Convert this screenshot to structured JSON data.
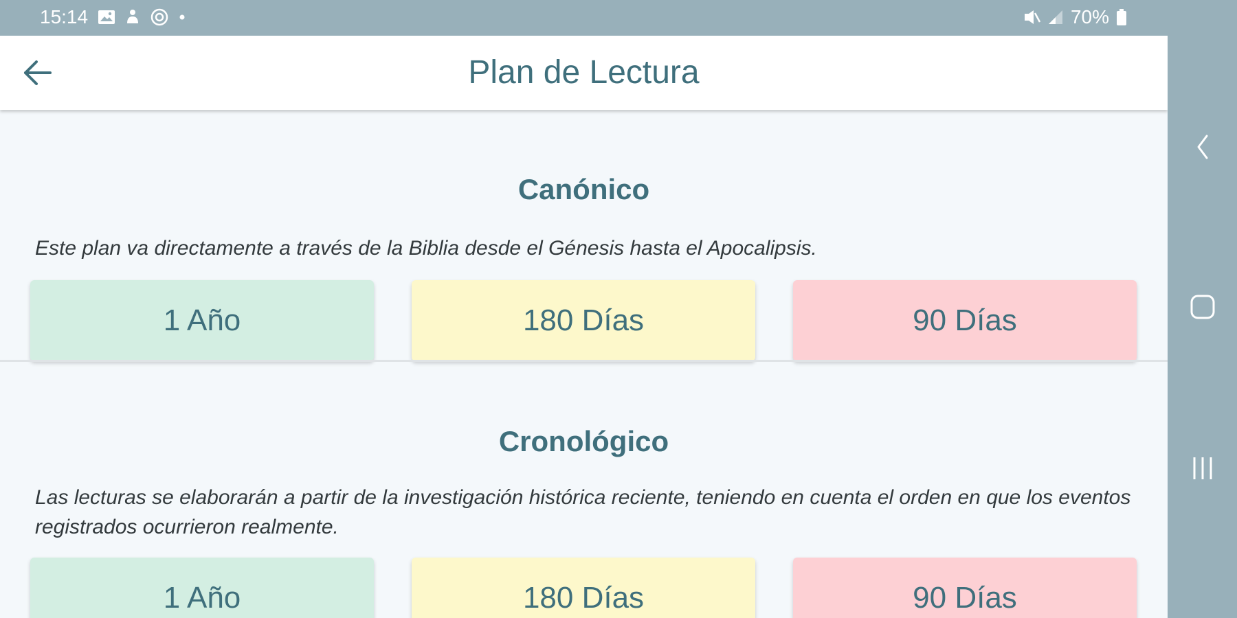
{
  "status_bar": {
    "time": "15:14",
    "battery": "70%",
    "icons": [
      "image-icon",
      "notification-icon",
      "at-sign-icon",
      "dot-icon",
      "mute-icon",
      "signal-icon",
      "battery-icon"
    ]
  },
  "app_bar": {
    "title": "Plan de Lectura",
    "back_icon": "arrow-left-icon"
  },
  "sections": [
    {
      "title": "Canónico",
      "description": "Este plan va directamente a través de la Biblia desde el Génesis hasta el Apocalipsis.",
      "options": [
        "1 Año",
        "180 Días",
        "90 Días"
      ]
    },
    {
      "title": "Cronológico",
      "description": "Las lecturas se elaborarán a partir de la investigación histórica reciente, teniendo en cuenta el orden en que los eventos registrados ocurrieron realmente.",
      "options": [
        "1 Año",
        "180 Días",
        "90 Días"
      ]
    }
  ],
  "colors": {
    "accent_text": "#3f6f7c",
    "status_bar": "#98b0ba",
    "option_green": "#d3eee2",
    "option_yellow": "#fdf8cb",
    "option_red": "#fdd0d4"
  },
  "nav_bar": {
    "icons": [
      "back-nav-icon",
      "home-nav-icon",
      "recents-nav-icon"
    ]
  }
}
